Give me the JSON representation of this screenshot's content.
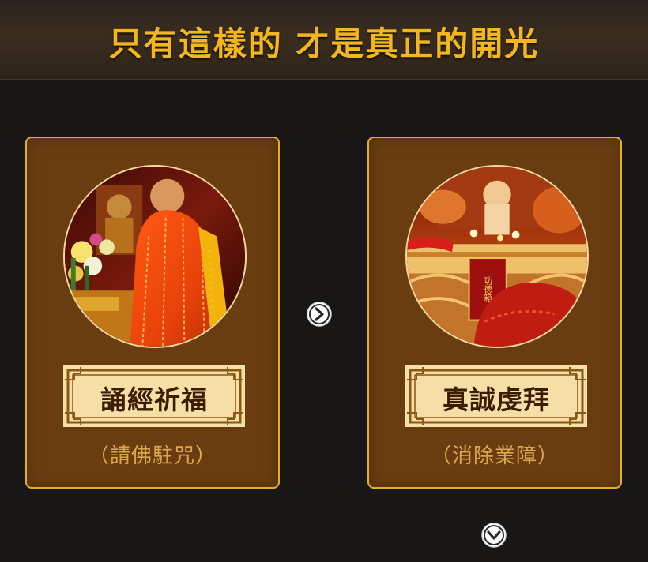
{
  "header": {
    "title": "只有這樣的 才是真正的開光"
  },
  "steps": [
    {
      "title": "誦經祈福",
      "subtitle": "（請佛駐咒）"
    },
    {
      "title": "真誠虔拜",
      "subtitle": "（消除業障）"
    }
  ],
  "photo_text": {
    "plaque": "功德箱"
  },
  "icons": {
    "next": "chevron-right-circle-icon",
    "down": "chevron-down-circle-icon"
  },
  "colors": {
    "background": "#181716",
    "accent_gold": "#f2b61f",
    "card_brown": "#6a3d11",
    "card_border": "#e0b128",
    "plaque_cream": "#f5dfa7",
    "subtitle_gold": "#d9a84d"
  }
}
